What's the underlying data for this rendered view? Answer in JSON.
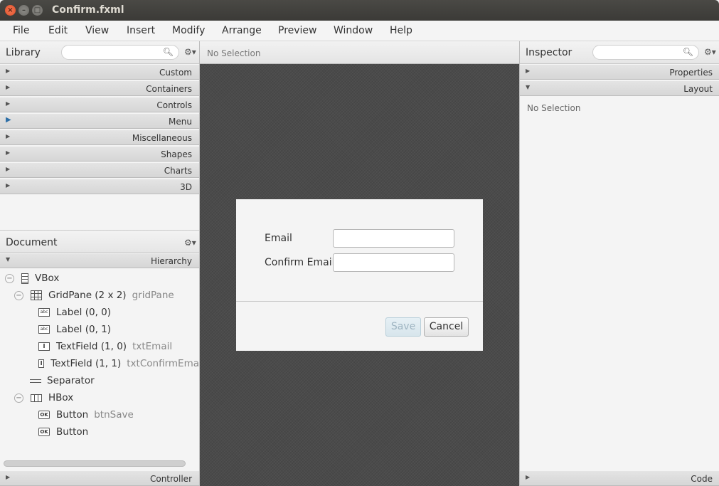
{
  "window": {
    "title": "Confirm.fxml"
  },
  "menu": [
    "File",
    "Edit",
    "View",
    "Insert",
    "Modify",
    "Arrange",
    "Preview",
    "Window",
    "Help"
  ],
  "library": {
    "title": "Library",
    "search_placeholder": "",
    "sections": [
      "Custom",
      "Containers",
      "Controls",
      "Menu",
      "Miscellaneous",
      "Shapes",
      "Charts",
      "3D"
    ]
  },
  "document": {
    "title": "Document",
    "hierarchy_label": "Hierarchy",
    "controller_label": "Controller",
    "tree": [
      {
        "label": "VBox",
        "sub": "",
        "icon": "vbox-icon"
      },
      {
        "label": "GridPane (2 x 2)",
        "sub": "gridPane",
        "icon": "gridpane-icon"
      },
      {
        "label": "Label (0, 0)",
        "sub": "",
        "icon": "label-icon"
      },
      {
        "label": "Label (0, 1)",
        "sub": "",
        "icon": "label-icon"
      },
      {
        "label": "TextField (1, 0)",
        "sub": "txtEmail",
        "icon": "textfield-icon"
      },
      {
        "label": "TextField (1, 1)",
        "sub": "txtConfirmEma",
        "icon": "textfield-icon"
      },
      {
        "label": "Separator",
        "sub": "",
        "icon": "separator-icon"
      },
      {
        "label": "HBox",
        "sub": "",
        "icon": "hbox-icon"
      },
      {
        "label": "Button",
        "sub": "btnSave",
        "icon": "button-icon"
      },
      {
        "label": "Button",
        "sub": "",
        "icon": "button-icon"
      }
    ]
  },
  "canvas": {
    "header": "No Selection",
    "dialog": {
      "email_label": "Email",
      "confirm_label": "Confirm Email",
      "email_value": "",
      "confirm_value": "",
      "save_label": "Save",
      "cancel_label": "Cancel"
    }
  },
  "inspector": {
    "title": "Inspector",
    "sections": [
      "Properties",
      "Layout"
    ],
    "empty_text": "No Selection",
    "code_label": "Code"
  },
  "icons": {
    "label": "abc",
    "textfield": "I",
    "button": "OK"
  }
}
